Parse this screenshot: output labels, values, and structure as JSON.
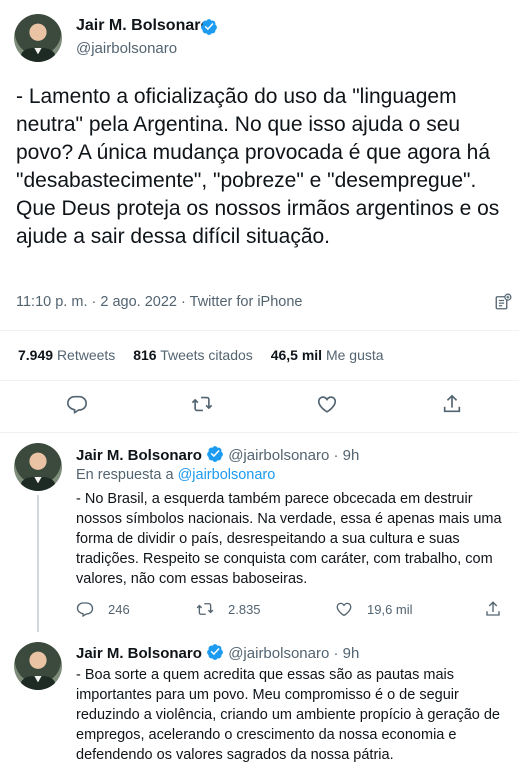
{
  "main_tweet": {
    "author_name": "Jair M. Bolsonaro",
    "author_handle": "@jairbolsonaro",
    "text": "- Lamento a oficialização do uso da \"linguagem neutra\" pela Argentina. No que isso ajuda o seu povo? A única mudança provocada é que agora há \"desabastecimente\", \"pobreze\" e \"desempregue\". Que Deus proteja os nossos irmãos argentinos e os ajude a sair dessa difícil situação.",
    "time": "11:10 p. m.",
    "date": "2 ago. 2022",
    "source": "Twitter for iPhone",
    "retweets_count": "7.949",
    "retweets_label": "Retweets",
    "quotes_count": "816",
    "quotes_label": "Tweets citados",
    "likes_count": "46,5 mil",
    "likes_label": "Me gusta",
    "separator": "·"
  },
  "replies": [
    {
      "author_name": "Jair M. Bolsonaro",
      "author_handle": "@jairbolsonaro",
      "age": "9h",
      "reply_to_prefix": "En respuesta a",
      "reply_to_handle": "@jairbolsonaro",
      "text": "- No Brasil, a esquerda também parece obcecada em destruir nossos símbolos nacionais. Na verdade, essa é apenas mais uma forma de dividir o país, desrespeitando a sua cultura e suas tradições. Respeito se conquista com caráter, com trabalho, com valores, não com essas baboseiras.",
      "reply_count": "246",
      "retweet_count": "2.835",
      "like_count": "19,6 mil"
    },
    {
      "author_name": "Jair M. Bolsonaro",
      "author_handle": "@jairbolsonaro",
      "age": "9h",
      "text": "- Boa sorte a quem acredita que essas são as pautas mais importantes para um povo. Meu compromisso é o de seguir reduzindo a violência, criando um ambiente propício à geração de empregos, acelerando o crescimento da nossa economia e defendendo os valores sagrados da nossa pátria."
    }
  ],
  "colors": {
    "accent": "#1d9bf0",
    "text": "#0f1419",
    "secondary": "#536471",
    "divider": "#eff3f4"
  },
  "icons": [
    "verified-badge-icon",
    "reply-icon",
    "retweet-icon",
    "like-icon",
    "share-icon",
    "analytics-icon"
  ]
}
